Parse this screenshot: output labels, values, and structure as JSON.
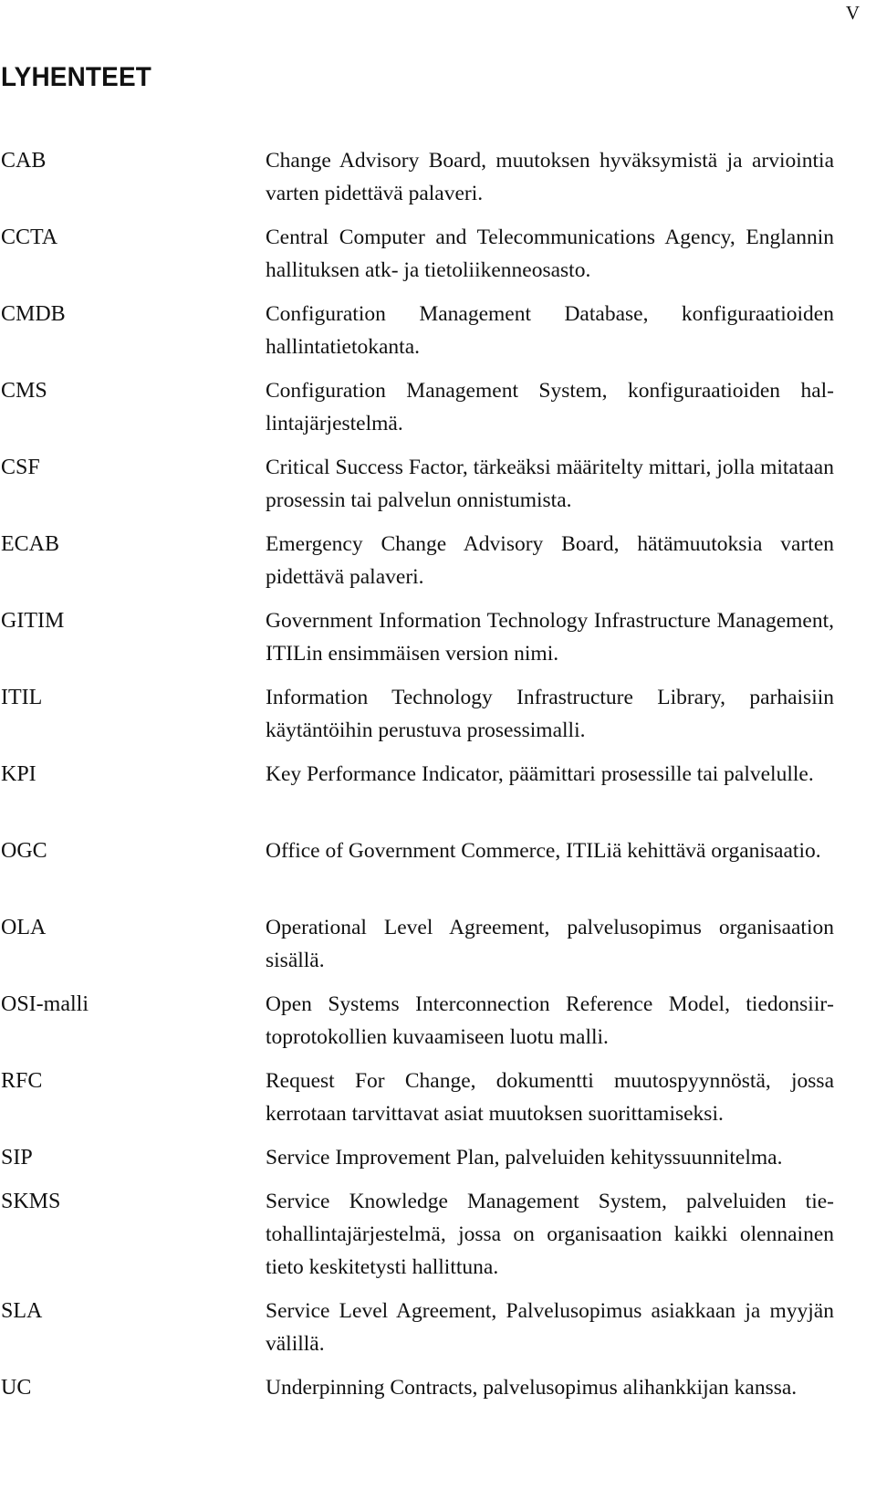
{
  "page": {
    "number": "V",
    "heading": "LYHENTEET"
  },
  "abbreviations": [
    {
      "abbr": "CAB",
      "definition": "Change Advisory Board, muutoksen hyväksymistä ja arvi­ointia varten pidettävä palaveri."
    },
    {
      "abbr": "CCTA",
      "definition": "Central Computer and Telecommunications Agency, Eng­lannin hallituksen atk- ja tietoliikenneosasto."
    },
    {
      "abbr": "CMDB",
      "definition": "Configuration Management Database, konfiguraatioiden hallintatietokanta."
    },
    {
      "abbr": "CMS",
      "definition": "Configuration Management System, konfiguraatioiden hal­lintajärjestelmä."
    },
    {
      "abbr": "CSF",
      "definition": "Critical Success Factor, tärkeäksi määritelty mittari, jolla mitataan prosessin tai palvelun onnistumista."
    },
    {
      "abbr": "ECAB",
      "definition": "Emergency Change Advisory Board, hätämuutoksia varten pidettävä palaveri."
    },
    {
      "abbr": "GITIM",
      "definition": "Government Information Technology Infrastructure Man­agement, ITILin ensimmäisen version nimi."
    },
    {
      "abbr": "ITIL",
      "definition": "Information Technology Infrastructure Library, parhaisiin käytäntöihin perustuva prosessimalli."
    },
    {
      "abbr": "KPI",
      "definition": "Key Performance Indicator, päämittari prosessille tai palve­lulle."
    },
    {
      "abbr": "OGC",
      "definition": "Office of Government Commerce, ITILiä kehittävä organ­isaatio."
    },
    {
      "abbr": "OLA",
      "definition": "Operational Level Agreement, palvelusopimus organisaati­on sisällä."
    },
    {
      "abbr": "OSI-malli",
      "definition": "Open Systems Interconnection Reference Model, tiedonsiir­toprotokollien kuvaamiseen luotu malli."
    },
    {
      "abbr": "RFC",
      "definition": "Request For Change, dokumentti muutospyynnöstä, jossa kerrotaan tarvittavat asiat muutoksen suorittamiseksi."
    },
    {
      "abbr": "SIP",
      "definition": "Service Improvement Plan, palveluiden kehityssuunnitelma."
    },
    {
      "abbr": "SKMS",
      "definition": "Service Knowledge Management System, palveluiden tie­tohallintajärjestelmä, jossa on organisaation kaikki olennai­nen tieto keskitetysti hallittuna."
    },
    {
      "abbr": "SLA",
      "definition": "Service Level Agreement, Palvelusopimus asiakkaan ja myyjän välillä."
    },
    {
      "abbr": "UC",
      "definition": "Underpinning Contracts, palvelusopimus alihankkijan kans­sa."
    }
  ]
}
